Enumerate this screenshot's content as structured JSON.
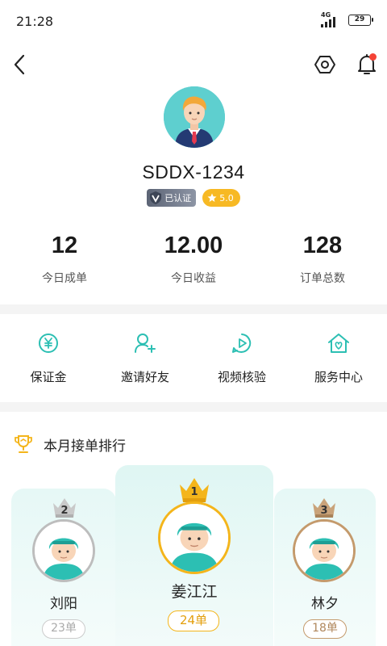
{
  "status_bar": {
    "time": "21:28",
    "network": "4G",
    "battery": "29"
  },
  "profile": {
    "username": "SDDX-1234",
    "verified_label": "已认证",
    "rating": "5.0"
  },
  "stats": [
    {
      "value": "12",
      "label": "今日成单"
    },
    {
      "value": "12.00",
      "label": "今日收益"
    },
    {
      "value": "128",
      "label": "订单总数"
    }
  ],
  "services": [
    {
      "label": "保证金",
      "icon": "deposit-yen-icon"
    },
    {
      "label": "邀请好友",
      "icon": "invite-user-icon"
    },
    {
      "label": "视频核验",
      "icon": "video-verify-icon"
    },
    {
      "label": "服务中心",
      "icon": "service-home-icon"
    }
  ],
  "ranking": {
    "title": "本月接单排行",
    "entries": [
      {
        "rank": "1",
        "name": "姜江江",
        "orders": "24单",
        "color": "#f4b51b"
      },
      {
        "rank": "2",
        "name": "刘阳",
        "orders": "23单",
        "color": "#bdbdbd"
      },
      {
        "rank": "3",
        "name": "林夕",
        "orders": "18单",
        "color": "#c49a6c"
      }
    ]
  },
  "colors": {
    "accent": "#2cbfb3",
    "bell_badge": "#f44336",
    "rating_badge": "#f7b924"
  }
}
